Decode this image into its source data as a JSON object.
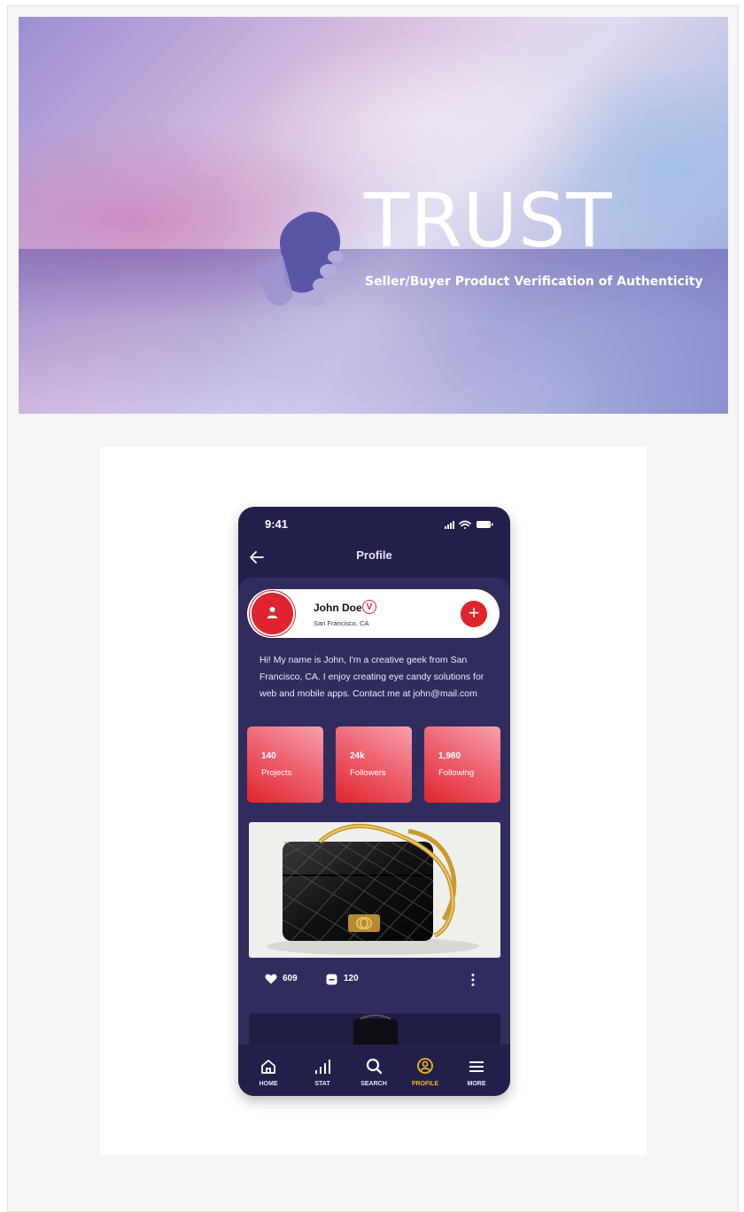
{
  "banner": {
    "title": "TRUST",
    "subtitle": "Seller/Buyer Product Verification of Authenticity",
    "logo_icon": "handshake-icon"
  },
  "phone": {
    "status_bar": {
      "time": "9:41",
      "icons": [
        "signal-icon",
        "wifi-icon",
        "battery-icon"
      ]
    },
    "header": {
      "title": "Profile",
      "back_icon": "back-arrow-icon"
    },
    "profile": {
      "name": "John Doe",
      "verified_badge": "V",
      "location": "San Francisco, CA",
      "bio": "Hi! My name is John, I'm a creative geek from San Francisco, CA. I enjoy creating eye candy solutions for web and mobile apps. Contact me at john@mail.com",
      "add_icon": "+"
    },
    "stats": [
      {
        "value": "140",
        "label": "Projects"
      },
      {
        "value": "24k",
        "label": "Followers"
      },
      {
        "value": "1,980",
        "label": "Following"
      }
    ],
    "post": {
      "image_alt": "black quilted handbag with gold chain",
      "likes": "609",
      "comments": "120"
    },
    "nav": [
      {
        "label": "HOME",
        "icon": "home-icon",
        "active": false
      },
      {
        "label": "STAT",
        "icon": "stat-icon",
        "active": false
      },
      {
        "label": "SEARCH",
        "icon": "search-icon",
        "active": false
      },
      {
        "label": "PROFILE",
        "icon": "profile-icon",
        "active": true
      },
      {
        "label": "MORE",
        "icon": "menu-icon",
        "active": false
      }
    ]
  },
  "colors": {
    "accent": "#e0242d",
    "phone_bg": "#22204a",
    "content_bg": "#302d5e",
    "active_nav": "#f0b51c"
  }
}
